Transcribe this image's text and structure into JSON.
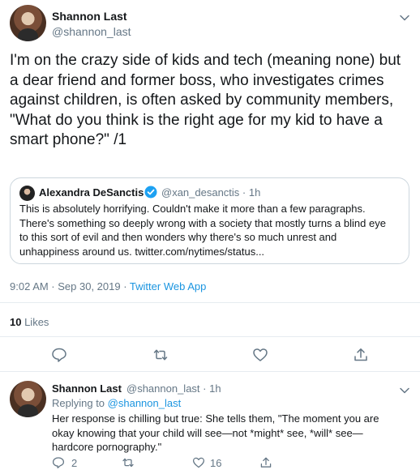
{
  "main_tweet": {
    "author_name": "Shannon Last",
    "author_handle": "@shannon_last",
    "text": "I'm on the crazy side of kids and tech (meaning none) but\na dear friend and former boss, who investigates crimes\nagainst children, is often asked by community members,\n\"What do you think is the right age for my kid to have a\nsmart phone?\" /1",
    "quoted": {
      "author_name": "Alexandra DeSanctis",
      "verified": true,
      "handle_time": "@xan_desanctis · 1h",
      "text": "This is absolutely horrifying. Couldn't make it more than a few paragraphs.\nThere's something so deeply wrong with a society that mostly turns a blind eye\nto this sort of evil and then wonders why there's so much unrest and\nunhappiness around us. twitter.com/nytimes/status..."
    },
    "timestamp": "9:02 AM · Sep 30, 2019 · ",
    "source": "Twitter Web App",
    "likes_count": "10",
    "likes_label": " Likes"
  },
  "reply_tweet": {
    "author_name": "Shannon Last",
    "handle_time": "@shannon_last · 1h",
    "replying_prefix": "Replying to ",
    "replying_to": "@shannon_last",
    "text": "Her response is chilling but true: She tells them, \"The moment you are\nokay knowing that your child will see—not *might* see, *will* see—\nhardcore pornography.\"",
    "reply_count": "2",
    "like_count": "16"
  },
  "colors": {
    "accent": "#1b95e0",
    "secondary_text": "#657786",
    "border": "#e6ecf0"
  },
  "icons": [
    "chevron-down-icon",
    "verified-badge-icon",
    "reply-icon",
    "retweet-icon",
    "like-icon",
    "share-icon"
  ]
}
